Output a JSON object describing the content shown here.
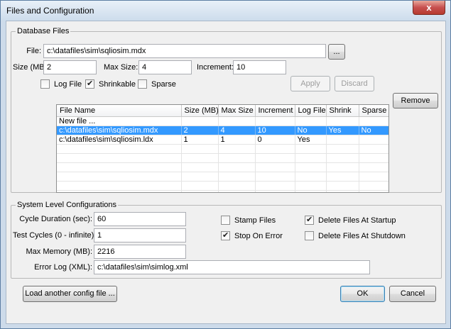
{
  "window": {
    "title": "Files and Configuration",
    "close_glyph": "x"
  },
  "database_files": {
    "group_label": "Database Files",
    "file_label": "File:",
    "file_value": "c:\\datafiles\\sim\\sqliosim.mdx",
    "browse_label": "...",
    "size_label": "Size (MB):",
    "size_value": "2",
    "max_size_label": "Max Size:",
    "max_size_value": "4",
    "increment_label": "Increment:",
    "increment_value": "10",
    "log_file_label": "Log File",
    "log_file_checked": false,
    "shrinkable_label": "Shrinkable",
    "shrinkable_checked": true,
    "sparse_label": "Sparse",
    "sparse_checked": false,
    "apply_label": "Apply",
    "discard_label": "Discard",
    "remove_label": "Remove",
    "columns": [
      "File Name",
      "Size (MB)",
      "Max Size",
      "Increment",
      "Log File",
      "Shrink",
      "Sparse"
    ],
    "rows": [
      {
        "cells": [
          "New file ...",
          "",
          "",
          "",
          "",
          "",
          ""
        ],
        "selected": false
      },
      {
        "cells": [
          "c:\\datafiles\\sim\\sqliosim.mdx",
          "2",
          "4",
          "10",
          "No",
          "Yes",
          "No"
        ],
        "selected": true
      },
      {
        "cells": [
          "c:\\datafiles\\sim\\sqliosim.ldx",
          "1",
          "1",
          "0",
          "Yes",
          "",
          ""
        ],
        "selected": false
      }
    ],
    "empty_rows": 6
  },
  "system_config": {
    "group_label": "System Level Configurations",
    "cycle_label": "Cycle Duration (sec):",
    "cycle_value": "60",
    "test_cycles_label": "Test Cycles (0 - infinite):",
    "test_cycles_value": "1",
    "max_memory_label": "Max Memory (MB):",
    "max_memory_value": "2216",
    "error_log_label": "Error Log (XML):",
    "error_log_value": "c:\\datafiles\\sim\\simlog.xml",
    "stamp_files_label": "Stamp Files",
    "stamp_files_checked": false,
    "stop_on_error_label": "Stop On Error",
    "stop_on_error_checked": true,
    "delete_startup_label": "Delete Files At Startup",
    "delete_startup_checked": true,
    "delete_shutdown_label": "Delete Files At Shutdown",
    "delete_shutdown_checked": false
  },
  "footer": {
    "load_label": "Load another config file ...",
    "ok_label": "OK",
    "cancel_label": "Cancel"
  },
  "colors": {
    "selection": "#3399ff",
    "title_gradient_top": "#e8f0f8",
    "close_red": "#c75050"
  }
}
